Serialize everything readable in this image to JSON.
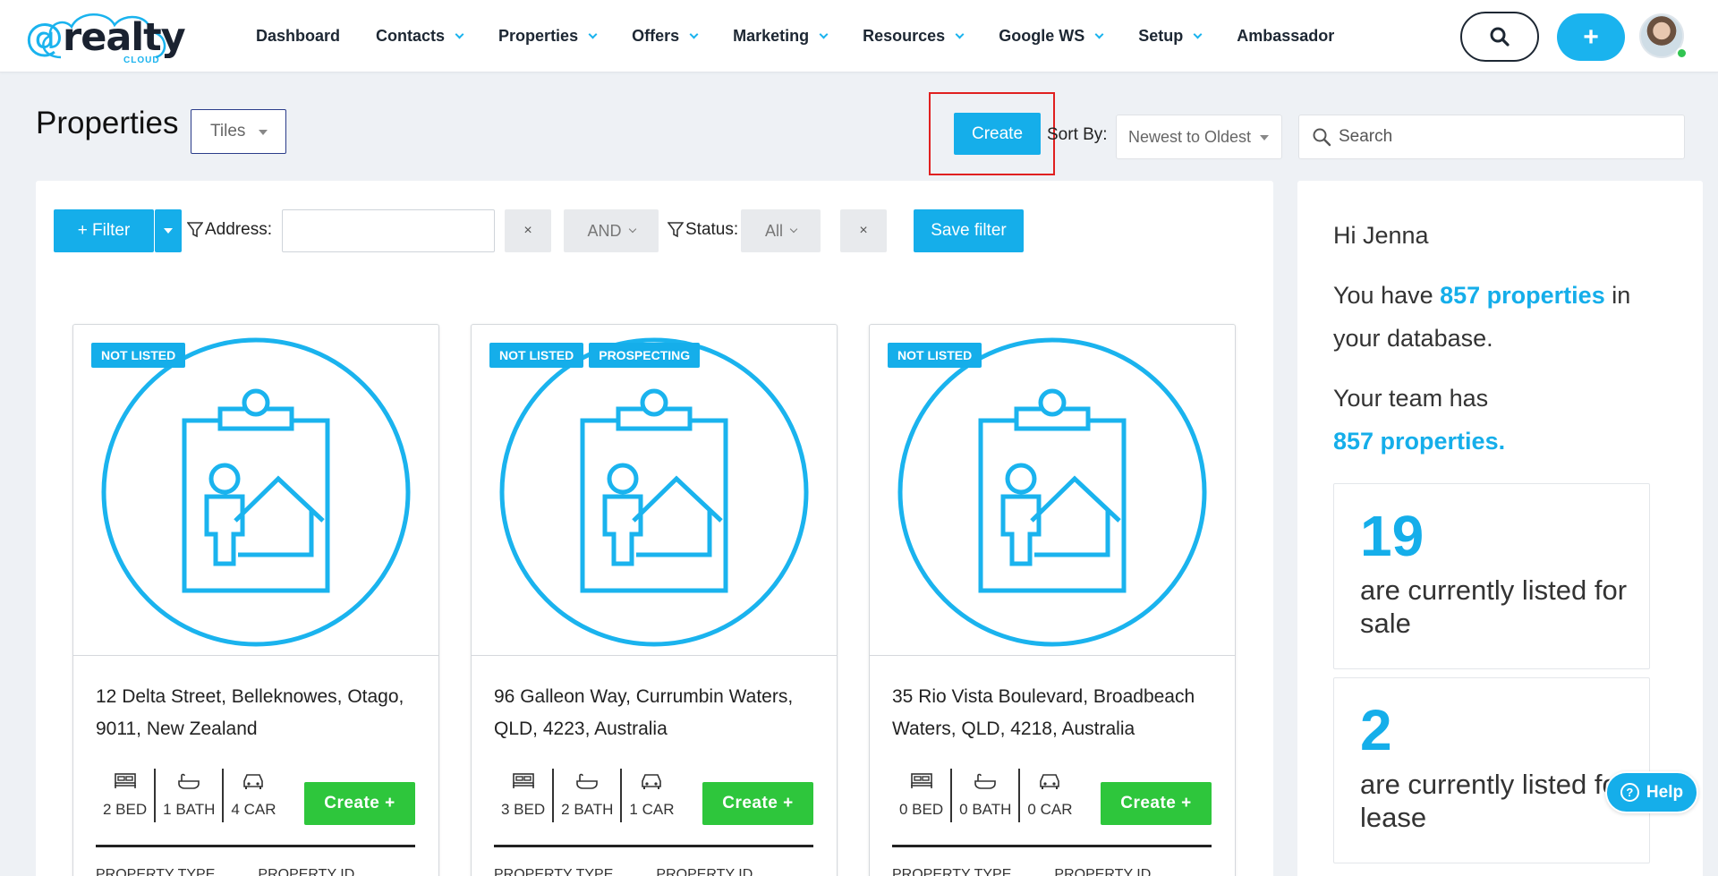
{
  "logo": {
    "at": "@",
    "name": "realty",
    "sub": "CLOUD"
  },
  "nav": [
    {
      "label": "Dashboard",
      "dropdown": false
    },
    {
      "label": "Contacts",
      "dropdown": true
    },
    {
      "label": "Properties",
      "dropdown": true
    },
    {
      "label": "Offers",
      "dropdown": true
    },
    {
      "label": "Marketing",
      "dropdown": true
    },
    {
      "label": "Resources",
      "dropdown": true
    },
    {
      "label": "Google WS",
      "dropdown": true
    },
    {
      "label": "Setup",
      "dropdown": true
    },
    {
      "label": "Ambassador",
      "dropdown": false
    }
  ],
  "header_actions": {
    "search_icon": "search-icon",
    "add_label": "+"
  },
  "page": {
    "title": "Properties",
    "view_select": "Tiles",
    "create_label": "Create",
    "sort_label": "Sort By:",
    "sort_value": "Newest to Oldest",
    "search_placeholder": "Search"
  },
  "filter": {
    "filter_label": "+ Filter",
    "address_label": "Address:",
    "address_value": "",
    "clear": "×",
    "operator": "AND",
    "status_label": "Status:",
    "status_value": "All",
    "save_label": "Save filter"
  },
  "properties": [
    {
      "badges": [
        "NOT LISTED"
      ],
      "address_line1": "12 Delta Street, Belleknowes, Otago,",
      "address_line2": "9011, New Zealand",
      "bed": "2 BED",
      "bath": "1 BATH",
      "car": "4 CAR",
      "create_label": "Create +",
      "meta": [
        "PROPERTY TYPE",
        "PROPERTY ID"
      ]
    },
    {
      "badges": [
        "NOT LISTED",
        "PROSPECTING"
      ],
      "address_line1": "96 Galleon Way, Currumbin Waters,",
      "address_line2": "QLD, 4223, Australia",
      "bed": "3 BED",
      "bath": "2 BATH",
      "car": "1 CAR",
      "create_label": "Create +",
      "meta": [
        "PROPERTY TYPE",
        "PROPERTY ID"
      ]
    },
    {
      "badges": [
        "NOT LISTED"
      ],
      "address_line1": "35 Rio Vista Boulevard, Broadbeach",
      "address_line2": "Waters, QLD, 4218, Australia",
      "bed": "0 BED",
      "bath": "0 BATH",
      "car": "0 CAR",
      "create_label": "Create +",
      "meta": [
        "PROPERTY TYPE",
        "PROPERTY ID"
      ]
    }
  ],
  "summary": {
    "greeting": "Hi Jenna",
    "line1_pre": "You have ",
    "line1_count": "857 properties",
    "line1_post": " in your database.",
    "line2_pre": "Your team has",
    "line2_count": "857 properties.",
    "stats": [
      {
        "number": "19",
        "text": "are currently listed for sale"
      },
      {
        "number": "2",
        "text": "are currently listed for lease"
      }
    ]
  },
  "help": {
    "label": "Help",
    "icon": "?"
  },
  "colors": {
    "accent": "#15aeea",
    "create_green": "#2ec63c",
    "highlight": "#e02020"
  }
}
